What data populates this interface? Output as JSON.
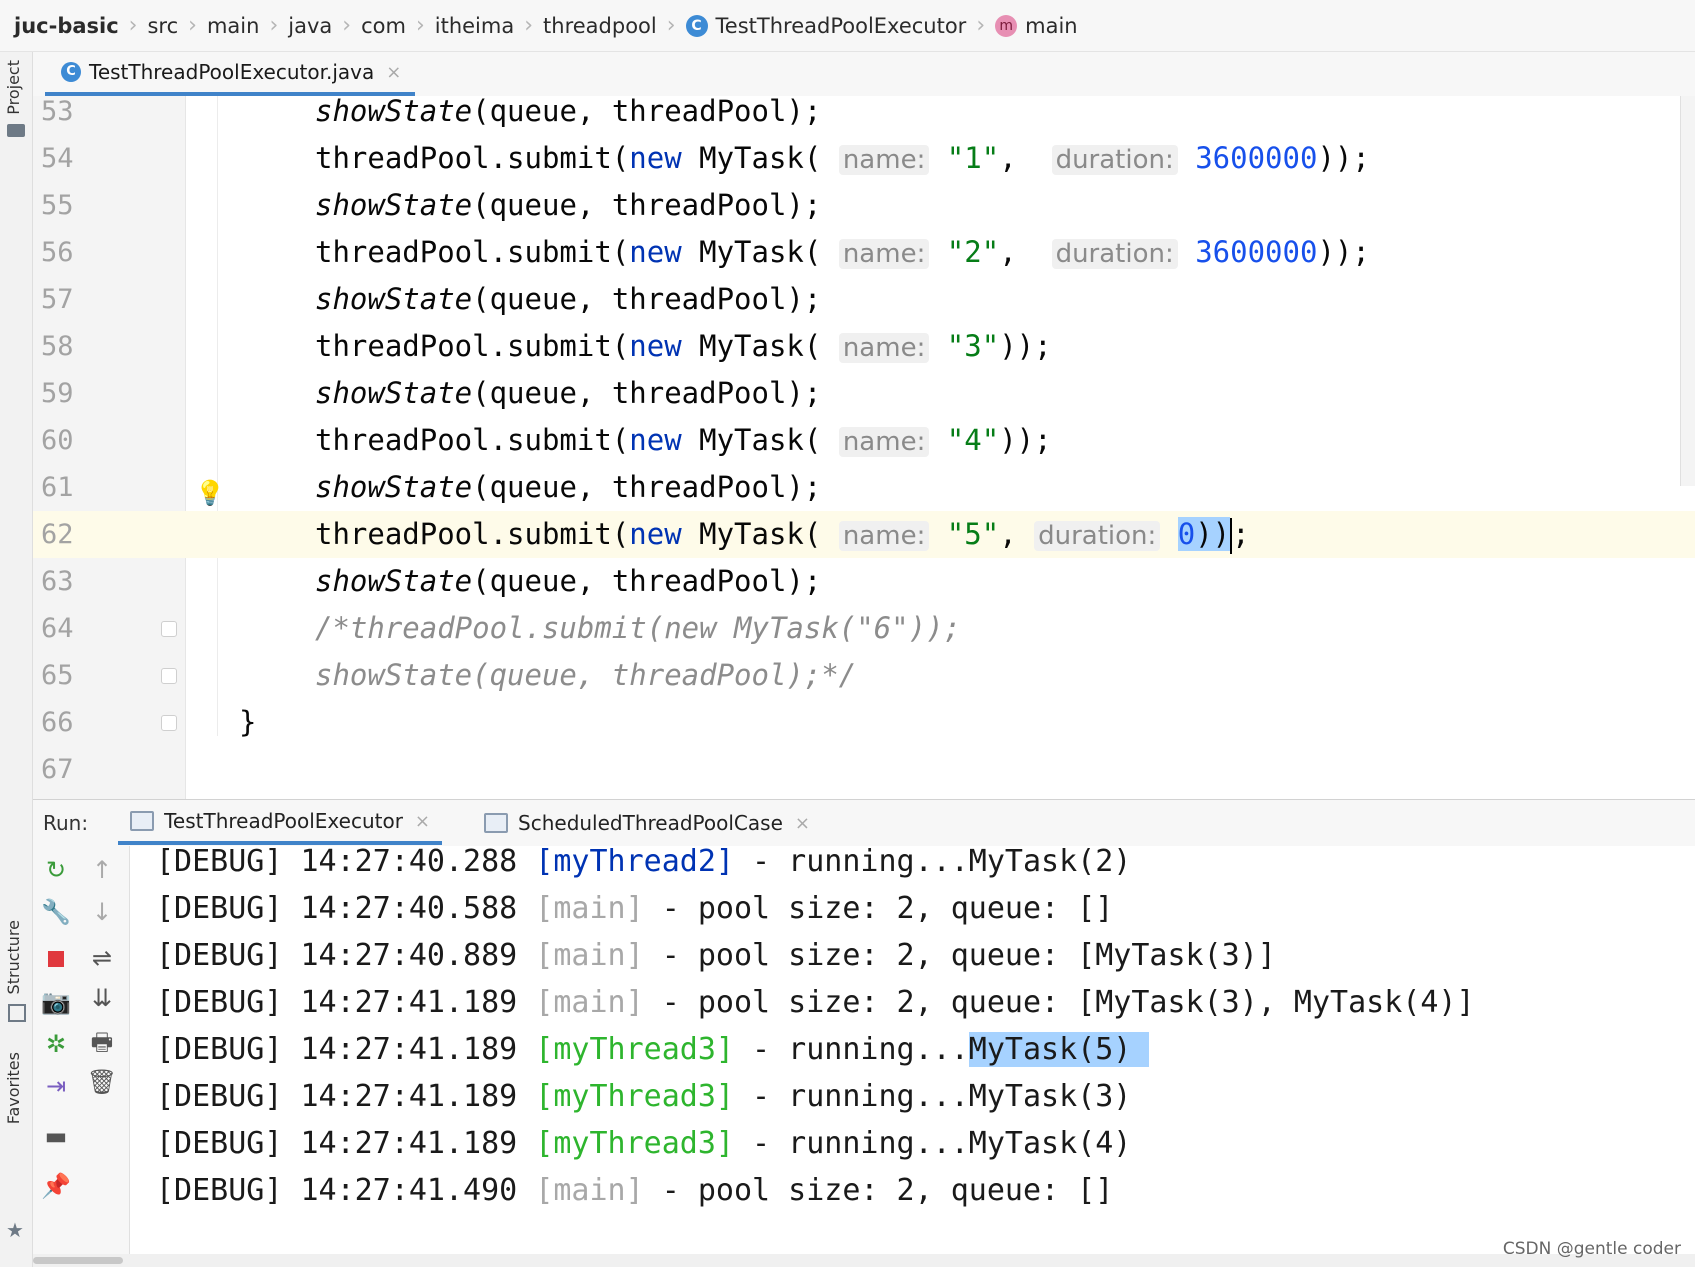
{
  "breadcrumb": {
    "items": [
      "juc-basic",
      "src",
      "main",
      "java",
      "com",
      "itheima",
      "threadpool",
      "TestThreadPoolExecutor",
      "main"
    ],
    "class_icon": "C",
    "method_icon": "m"
  },
  "left_strip": {
    "project_label": "Project",
    "structure_label": "Structure",
    "favorites_label": "Favorites"
  },
  "editor": {
    "tab_label": "TestThreadPoolExecutor.java",
    "tab_close": "×",
    "line_numbers": [
      "53",
      "54",
      "55",
      "56",
      "57",
      "58",
      "59",
      "60",
      "61",
      "62",
      "63",
      "64",
      "65",
      "66",
      "67"
    ],
    "lines": {
      "l53": {
        "call": "showState",
        "args": "(queue, threadPool);"
      },
      "l54": {
        "obj": "threadPool.submit(",
        "kw": "new",
        "cls": " MyTask(",
        "hint1": "name:",
        "str": "\"1\"",
        "comma": ", ",
        "hint2": "duration:",
        "num": "3600000",
        "end": "));"
      },
      "l55": {
        "call": "showState",
        "args": "(queue, threadPool);"
      },
      "l56": {
        "obj": "threadPool.submit(",
        "kw": "new",
        "cls": " MyTask(",
        "hint1": "name:",
        "str": "\"2\"",
        "comma": ", ",
        "hint2": "duration:",
        "num": "3600000",
        "end": "));"
      },
      "l57": {
        "call": "showState",
        "args": "(queue, threadPool);"
      },
      "l58": {
        "obj": "threadPool.submit(",
        "kw": "new",
        "cls": " MyTask(",
        "hint1": "name:",
        "str": "\"3\"",
        "end": "));"
      },
      "l59": {
        "call": "showState",
        "args": "(queue, threadPool);"
      },
      "l60": {
        "obj": "threadPool.submit(",
        "kw": "new",
        "cls": " MyTask(",
        "hint1": "name:",
        "str": "\"4\"",
        "end": "));"
      },
      "l61": {
        "call": "showState",
        "args": "(queue, threadPool);"
      },
      "l62": {
        "obj": "threadPool.submit(",
        "kw": "new",
        "cls": " MyTask(",
        "hint1": "name:",
        "str": "\"5\"",
        "comma": ", ",
        "hint2": "duration:",
        "num": "0",
        "end_sel": "))",
        "end": ";"
      },
      "l63": {
        "call": "showState",
        "args": "(queue, threadPool);"
      },
      "l64": {
        "comment": "/*threadPool.submit(new MyTask(\"6\"));"
      },
      "l65": {
        "comment": "showState(queue, threadPool);*/"
      },
      "l66": {
        "brace": "}"
      }
    }
  },
  "run": {
    "label": "Run:",
    "tabs": [
      "TestThreadPoolExecutor",
      "ScheduledThreadPoolCase"
    ],
    "tab_close": "×",
    "console": [
      {
        "prefix": "[DEBUG] 14:27:40.288 ",
        "thread": "[myThread2]",
        "style": "blue",
        "msg": " - running...MyTask(2)"
      },
      {
        "prefix": "[DEBUG] 14:27:40.588 ",
        "thread": "[main]",
        "style": "main",
        "msg": " - pool size: 2, queue: []"
      },
      {
        "prefix": "[DEBUG] 14:27:40.889 ",
        "thread": "[main]",
        "style": "main",
        "msg": " - pool size: 2, queue: [MyTask(3)]"
      },
      {
        "prefix": "[DEBUG] 14:27:41.189 ",
        "thread": "[main]",
        "style": "main",
        "msg": " - pool size: 2, queue: [MyTask(3), MyTask(4)]"
      },
      {
        "prefix": "[DEBUG] 14:27:41.189 ",
        "thread": "[myThread3]",
        "style": "green",
        "msg": " - running...",
        "msg_hl": "MyTask(5) "
      },
      {
        "prefix": "[DEBUG] 14:27:41.189 ",
        "thread": "[myThread3]",
        "style": "green",
        "msg": " - running...MyTask(3)"
      },
      {
        "prefix": "[DEBUG] 14:27:41.189 ",
        "thread": "[myThread3]",
        "style": "green",
        "msg": " - running...MyTask(4)"
      },
      {
        "prefix": "[DEBUG] 14:27:41.490 ",
        "thread": "[main]",
        "style": "main",
        "msg": " - pool size: 2, queue: []"
      }
    ]
  },
  "watermark": "CSDN @gentle coder",
  "colors": {
    "accent": "#4083c9",
    "keyword": "#0033b3",
    "string": "#067d17",
    "number": "#1750eb",
    "green_thread": "#2eb52e",
    "selection": "#a6d2ff"
  }
}
